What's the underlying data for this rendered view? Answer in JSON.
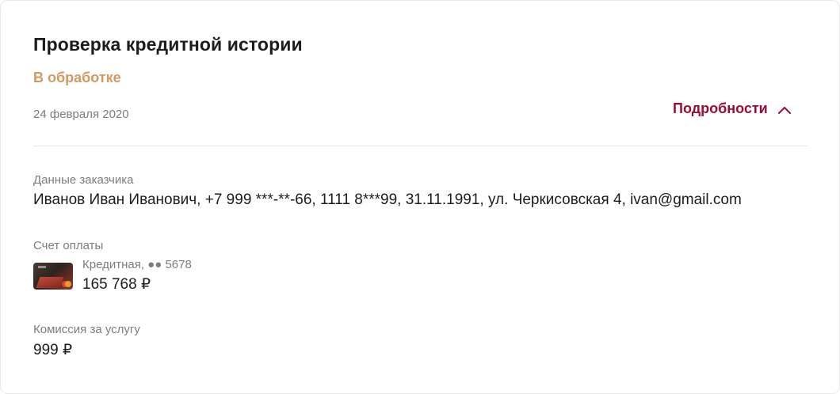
{
  "order": {
    "title": "Проверка кредитной истории",
    "status": "В обработке",
    "date": "24 февраля 2020",
    "details_label": "Подробности"
  },
  "customer": {
    "label": "Данные заказчика",
    "value": "Иванов Иван Иванович, +7 999 ***-**-66, 1111 8***99, 31.11.1991, ул. Черкисовская 4, ivan@gmail.com"
  },
  "payment_account": {
    "label": "Счет оплаты",
    "card_type_mask": "Кредитная, ●● 5678",
    "amount": "165 768 ₽"
  },
  "commission": {
    "label": "Комиссия за услугу",
    "value": "999 ₽"
  },
  "icons": {
    "details_toggle": "chevron-up-icon",
    "card": "credit-card-thumbnail"
  },
  "colors": {
    "status": "#d29a60",
    "accent": "#9b0b34"
  }
}
